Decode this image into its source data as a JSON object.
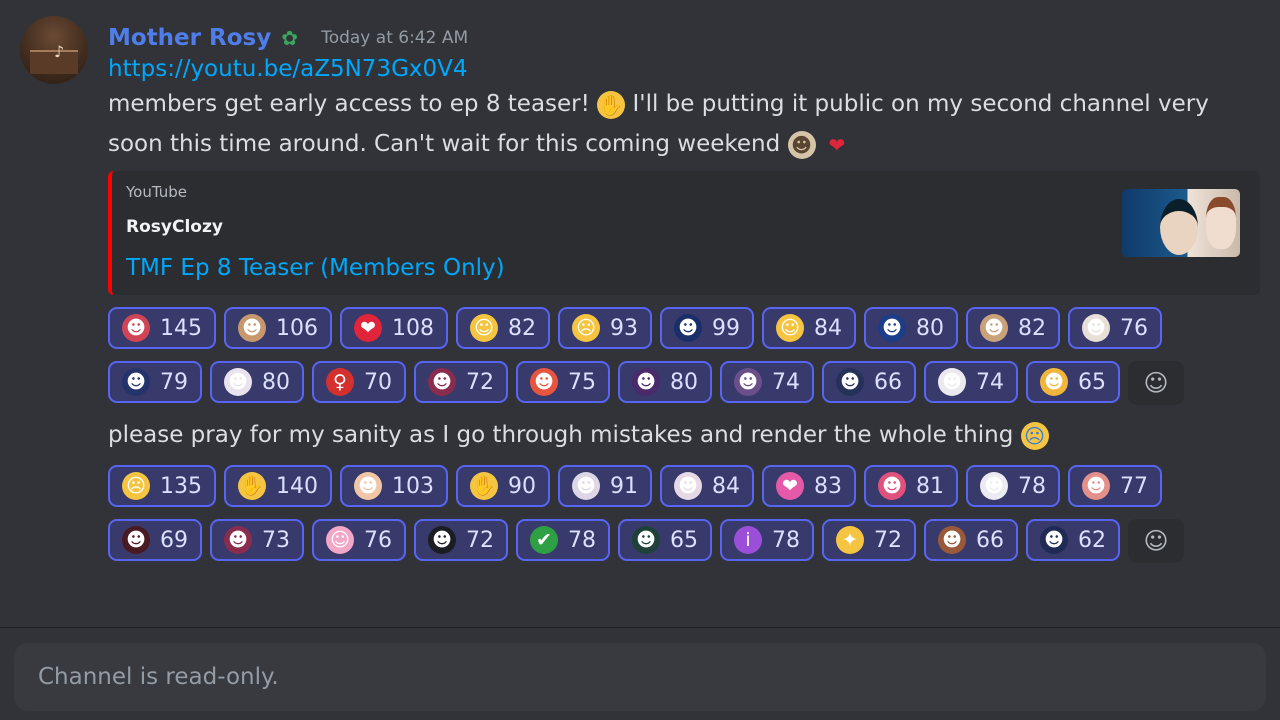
{
  "message": {
    "username": "Mother Rosy",
    "role_icon": "goblin-role-icon",
    "timestamp": "Today at 6:42 AM",
    "link": "https://youtu.be/aZ5N73Gx0V4",
    "text_part1": "members get early access to ep 8 teaser!",
    "text_part2": "I'll be putting it public on my second channel very soon this time around. Can't wait for this coming weekend",
    "embed": {
      "provider": "YouTube",
      "author": "RosyClozy",
      "title": "TMF Ep 8 Teaser (Members Only)",
      "accent_color": "#ff0000"
    },
    "second_text": "please pray for my sanity as I go through mistakes and render the whole thing"
  },
  "reactions1": [
    {
      "emoji": "anime-red-hair",
      "glyph": "☻",
      "color": "#d04455",
      "count": "145"
    },
    {
      "emoji": "anime-brown-hair",
      "glyph": "☻",
      "color": "#c7986e",
      "count": "106"
    },
    {
      "emoji": "red-heart",
      "glyph": "❤",
      "color": "#e0243a",
      "count": "108"
    },
    {
      "emoji": "grinning-face",
      "glyph": "☺",
      "color": "#f5c542",
      "count": "82"
    },
    {
      "emoji": "scream-face",
      "glyph": "☹",
      "color": "#f5c542",
      "count": "93"
    },
    {
      "emoji": "anime-dark-hair",
      "glyph": "☻",
      "color": "#1a2e6a",
      "count": "99"
    },
    {
      "emoji": "party-face",
      "glyph": "☺",
      "color": "#f5c542",
      "count": "84"
    },
    {
      "emoji": "anime-blue-hair",
      "glyph": "☻",
      "color": "#1c3d88",
      "count": "80"
    },
    {
      "emoji": "small-figure",
      "glyph": "☻",
      "color": "#c9a27a",
      "count": "82"
    },
    {
      "emoji": "angel-anime",
      "glyph": "☻",
      "color": "#e8e0d8",
      "count": "76"
    },
    {
      "emoji": "anime-navy-hair",
      "glyph": "☻",
      "color": "#24336b",
      "count": "79"
    }
  ],
  "reactions2": [
    {
      "emoji": "anime-white-hair",
      "glyph": "☻",
      "color": "#e8e3ef",
      "count": "80"
    },
    {
      "emoji": "dancer",
      "glyph": "♀",
      "color": "#d4302d",
      "count": "70"
    },
    {
      "emoji": "anime-purple",
      "glyph": "☻",
      "color": "#8a2c4d",
      "count": "72"
    },
    {
      "emoji": "anime-orange",
      "glyph": "☻",
      "color": "#e8553f",
      "count": "75"
    },
    {
      "emoji": "anime-dark-purple",
      "glyph": "☻",
      "color": "#4a2a6a",
      "count": "80"
    },
    {
      "emoji": "anime-lavender",
      "glyph": "☻",
      "color": "#6a4f8a",
      "count": "74"
    },
    {
      "emoji": "anime-sitting",
      "glyph": "☻",
      "color": "#263159",
      "count": "66"
    },
    {
      "emoji": "anime-ghost",
      "glyph": "☻",
      "color": "#e9e9ee",
      "count": "74"
    },
    {
      "emoji": "cat-face",
      "glyph": "☻",
      "color": "#f2b53b",
      "count": "65"
    }
  ],
  "reactions3": [
    {
      "emoji": "anxious-face",
      "glyph": "☹",
      "color": "#f5c542",
      "count": "135"
    },
    {
      "emoji": "folded-hands",
      "glyph": "✋",
      "color": "#f5c542",
      "count": "140"
    },
    {
      "emoji": "anime-yes-sign",
      "glyph": "☻",
      "color": "#f0c6a6",
      "count": "103"
    },
    {
      "emoji": "palms-up",
      "glyph": "✋",
      "color": "#f5c542",
      "count": "90"
    },
    {
      "emoji": "anime-silver",
      "glyph": "☻",
      "color": "#dcd6e6",
      "count": "91"
    },
    {
      "emoji": "anime-cat-ears",
      "glyph": "☻",
      "color": "#e7d8e6",
      "count": "84"
    },
    {
      "emoji": "two-hearts",
      "glyph": "❤",
      "color": "#e55aa8",
      "count": "83"
    },
    {
      "emoji": "anime-pink",
      "glyph": "☻",
      "color": "#e0517d",
      "count": "81"
    },
    {
      "emoji": "anime-white-long",
      "glyph": "☻",
      "color": "#eceaf2",
      "count": "78"
    },
    {
      "emoji": "anime-salmon",
      "glyph": "☻",
      "color": "#e38f8a",
      "count": "77"
    },
    {
      "emoji": "anime-dark-red",
      "glyph": "☻",
      "color": "#4a1a22",
      "count": "69"
    }
  ],
  "reactions4": [
    {
      "emoji": "anime-maroon",
      "glyph": "☻",
      "color": "#8a2c4d",
      "count": "73"
    },
    {
      "emoji": "pig-face",
      "glyph": "☺",
      "color": "#f3a7c8",
      "count": "76"
    },
    {
      "emoji": "anime-black-hair",
      "glyph": "☻",
      "color": "#1c1c24",
      "count": "72"
    },
    {
      "emoji": "check-mark-button",
      "glyph": "✔",
      "color": "#2ea043",
      "count": "78"
    },
    {
      "emoji": "anime-green-hair",
      "glyph": "☻",
      "color": "#20403a",
      "count": "65"
    },
    {
      "emoji": "info-button",
      "glyph": "i",
      "color": "#9b4fd8",
      "count": "78"
    },
    {
      "emoji": "sparkles",
      "glyph": "✦",
      "color": "#f5c542",
      "count": "72"
    },
    {
      "emoji": "anime-brown",
      "glyph": "☻",
      "color": "#9a5a3a",
      "count": "66"
    },
    {
      "emoji": "anime-navy-long",
      "glyph": "☻",
      "color": "#1f2a55",
      "count": "62"
    }
  ],
  "composer": {
    "placeholder": "Channel is read-only."
  }
}
